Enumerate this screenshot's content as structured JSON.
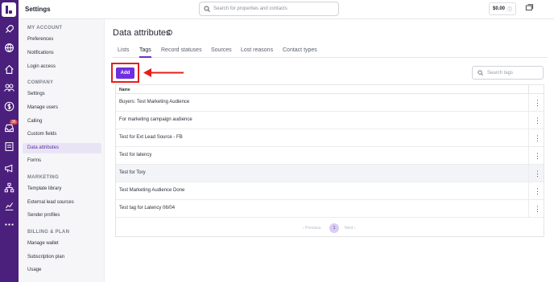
{
  "header": {
    "title": "Settings",
    "search_placeholder": "Search for properties and contacts",
    "wallet_balance": "$0.00",
    "wallet_info_icon": "info-icon",
    "more_label": "i"
  },
  "rail": {
    "badge_count": "36",
    "icons": [
      "logo",
      "rocket-icon",
      "globe-icon",
      "home-icon",
      "users-icon",
      "dollar-icon",
      "inbox-icon",
      "list-icon",
      "megaphone-icon",
      "sitemap-icon",
      "chart-icon",
      "more-dots-icon"
    ]
  },
  "sidebar": {
    "sections": [
      {
        "title": "MY ACCOUNT",
        "items": [
          "Preferences",
          "Notifications",
          "Login access"
        ]
      },
      {
        "title": "COMPANY",
        "items": [
          "Settings",
          "Manage users",
          "Calling",
          "Custom fields",
          "Data attributes",
          "Forms"
        ]
      },
      {
        "title": "MARKETING",
        "items": [
          "Template library",
          "External lead sources",
          "Sender profiles"
        ]
      },
      {
        "title": "BILLING & PLAN",
        "items": [
          "Manage wallet",
          "Subscription plan",
          "Usage"
        ]
      }
    ],
    "active_item": "Data attributes"
  },
  "main": {
    "title": "Data attributes",
    "tabs": [
      "Lists",
      "Tags",
      "Record statuses",
      "Sources",
      "Lost reasons",
      "Contact types"
    ],
    "active_tab": "Tags",
    "add_label": "Add",
    "search_placeholder": "Search tags",
    "table": {
      "header_name": "Name",
      "rows": [
        "Buyers: Test Marketing Audience",
        "For marketing campaign audience",
        "Test for Ext Lead Source - FB",
        "Test for latency",
        "Test for Tory",
        "Test Marketing Audience Done",
        "Test tag for Latency 06/04"
      ],
      "highlighted_row": "Test for Tory"
    },
    "pagination": {
      "prev": "‹ Previous",
      "current": "1",
      "next": "Next ›"
    }
  },
  "colors": {
    "rail": "#4b1f7c",
    "accent": "#6f2fe0",
    "annotation": "#e3201b"
  }
}
